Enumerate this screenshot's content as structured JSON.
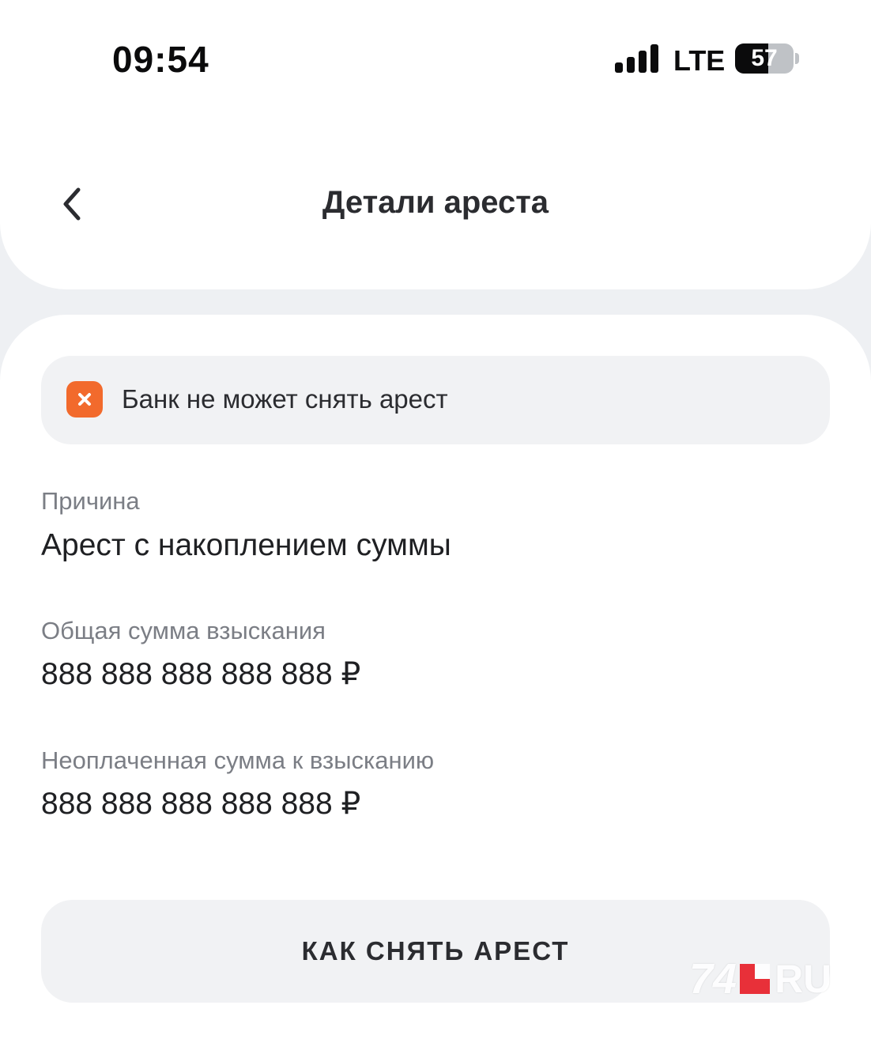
{
  "status_bar": {
    "time": "09:54",
    "network": "LTE",
    "battery": "57",
    "battery_level": 0.57
  },
  "header": {
    "title": "Детали ареста",
    "back_icon": "chevron-left-icon"
  },
  "status_banner": {
    "icon": "close-icon",
    "icon_color": "#f26a2c",
    "text": "Банк не может снять арест"
  },
  "fields": {
    "reason": {
      "label": "Причина",
      "value": "Арест с накоплением суммы"
    },
    "total_amount": {
      "label": "Общая сумма взыскания",
      "value": "888 888 888 888 888 ₽"
    },
    "unpaid_amount": {
      "label": "Неоплаченная сумма к взысканию",
      "value": "888 888 888 888 888 ₽"
    }
  },
  "action": {
    "label": "КАК СНЯТЬ АРЕСТ"
  },
  "watermark": {
    "number": "74",
    "suffix": "RU",
    "accent": "#e8202a"
  }
}
